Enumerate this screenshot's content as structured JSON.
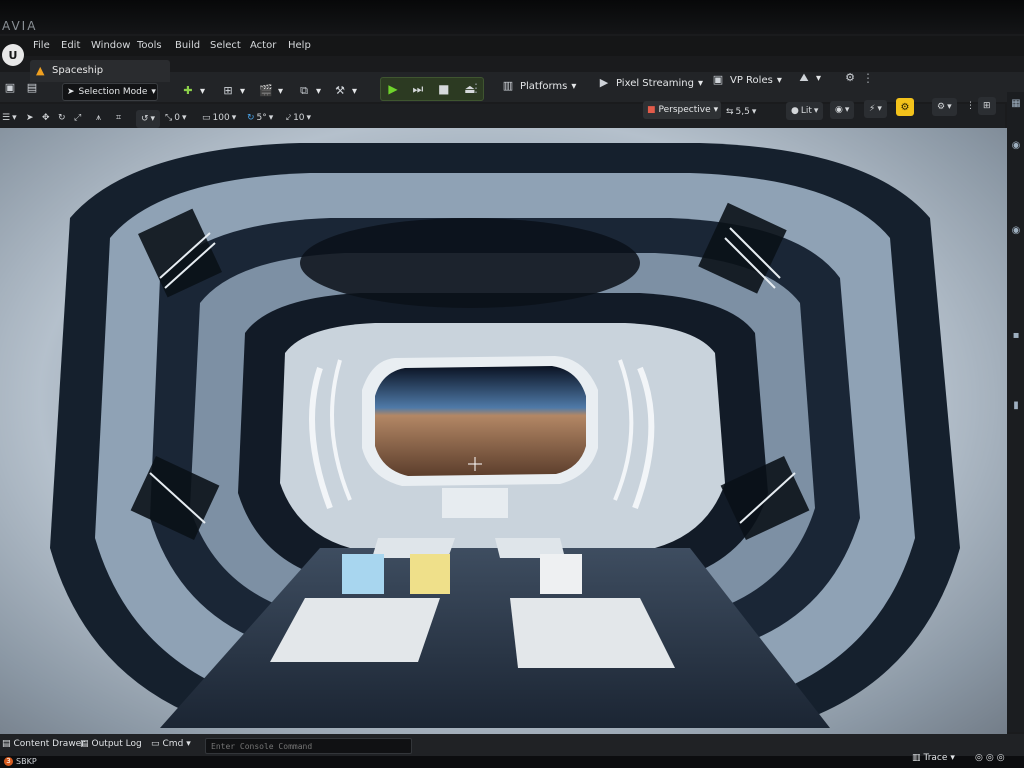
{
  "app": {
    "title": "AVIA"
  },
  "menu": [
    "File",
    "Edit",
    "Window",
    "Tools",
    "Build",
    "Select",
    "Actor",
    "Help"
  ],
  "tab": {
    "label": "Spaceship"
  },
  "toolbar": {
    "mode": "Selection Mode",
    "platforms": "Platforms",
    "pixel_streaming": "Pixel Streaming",
    "vp_roles": "VP Roles"
  },
  "viewport_toolbar": {
    "perspective": "Perspective",
    "camera_speed": "5,5",
    "lit": "Lit",
    "rotation_snap": "0",
    "scale_snap": "100",
    "angle_snap": "5°",
    "grid_snap": "10"
  },
  "bottom": {
    "content_drawer": "Content Drawer",
    "output_log": "Output Log",
    "cmd": "Cmd",
    "console_placeholder": "Enter Console Command",
    "trace": "Trace"
  },
  "taskbar": {
    "badge": "3",
    "label": "SBKP"
  },
  "colors": {
    "play_green": "#6fd42c",
    "warning_orange": "#f0a020",
    "highlight_yellow": "#f3c21b"
  }
}
